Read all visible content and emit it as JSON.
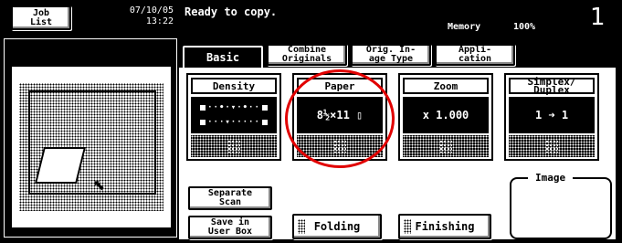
{
  "header": {
    "job_list": [
      "Job",
      "List"
    ],
    "date": "07/10/05",
    "time": "13:22",
    "status": "Ready to copy.",
    "memory_label": "Memory",
    "memory_value": "100%",
    "copy_count": "1"
  },
  "tabs": [
    {
      "label": "Basic",
      "active": true
    },
    {
      "label": "Combine Originals",
      "lines": [
        "Combine",
        "Originals"
      ]
    },
    {
      "label": "Original Image Type",
      "lines": [
        "Orig. In-",
        "age Type"
      ]
    },
    {
      "label": "Application",
      "lines": [
        "Appli-",
        "cation"
      ]
    }
  ],
  "functions": {
    "density": {
      "label": "Density"
    },
    "paper": {
      "label": "Paper",
      "value": "8½×11 ▯"
    },
    "zoom": {
      "label": "Zoom",
      "value": "x 1.000"
    },
    "simplex": {
      "label_lines": [
        "Simplex/",
        "Duplex"
      ],
      "value": "1 ➜ 1"
    }
  },
  "buttons": {
    "separate_scan": [
      "Separate",
      "Scan"
    ],
    "save_user_box": [
      "Save in",
      "User Box"
    ],
    "folding": "Folding",
    "finishing": "Finishing"
  },
  "image_panel": {
    "label": "Image"
  },
  "colors": {
    "highlight": "#e10000"
  }
}
